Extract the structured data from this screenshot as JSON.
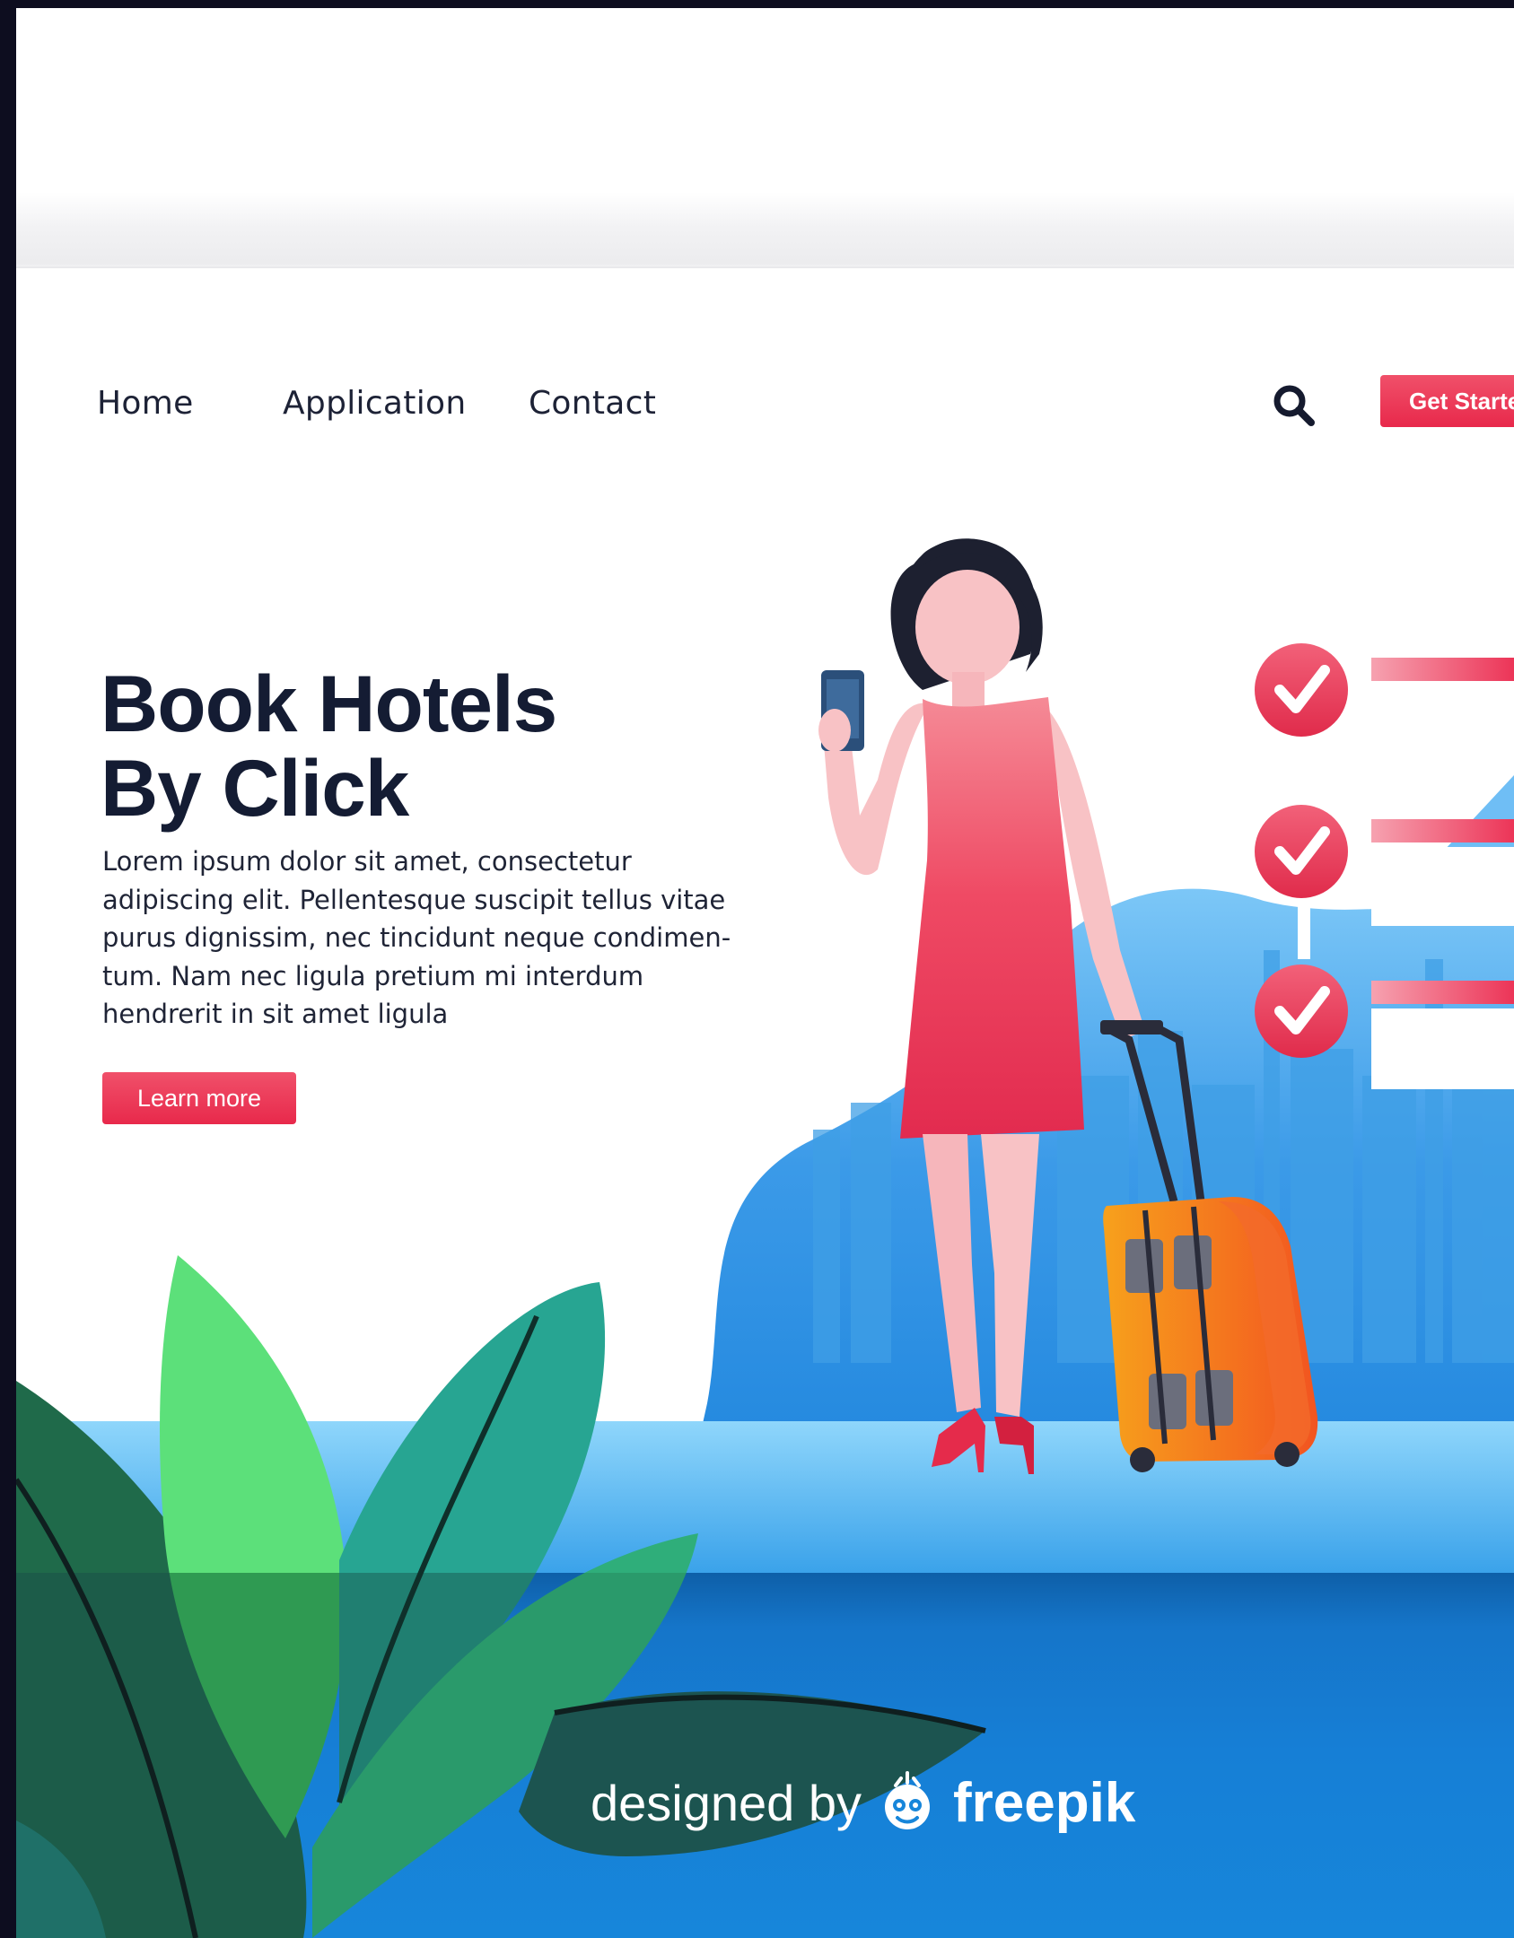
{
  "nav": {
    "items": [
      "Home",
      "Application",
      "Contact"
    ],
    "cta_label": "Get Started"
  },
  "hero": {
    "title_lines": [
      "Book Hotels",
      "By Click"
    ],
    "body_lines": [
      "Lorem ipsum dolor sit amet, consectetur",
      "adipiscing elit. Pellentesque suscipit tellus vitae",
      "purus dignissim, nec tincidunt neque condimen-",
      "tum. Nam nec ligula pretium mi interdum",
      "hendrerit in sit amet ligula"
    ],
    "button_label": "Learn more"
  },
  "watermark": {
    "designed_by": "designed by",
    "brand": "freepik"
  },
  "icons": {
    "search": "search-icon",
    "check": "check-circle-icon",
    "logo": "freepik-logo-icon"
  },
  "colors": {
    "accent": "#e8294b",
    "heading": "#141c33",
    "sky_blue": "#2f8fe0",
    "page_bg": "#0d0d1f"
  }
}
